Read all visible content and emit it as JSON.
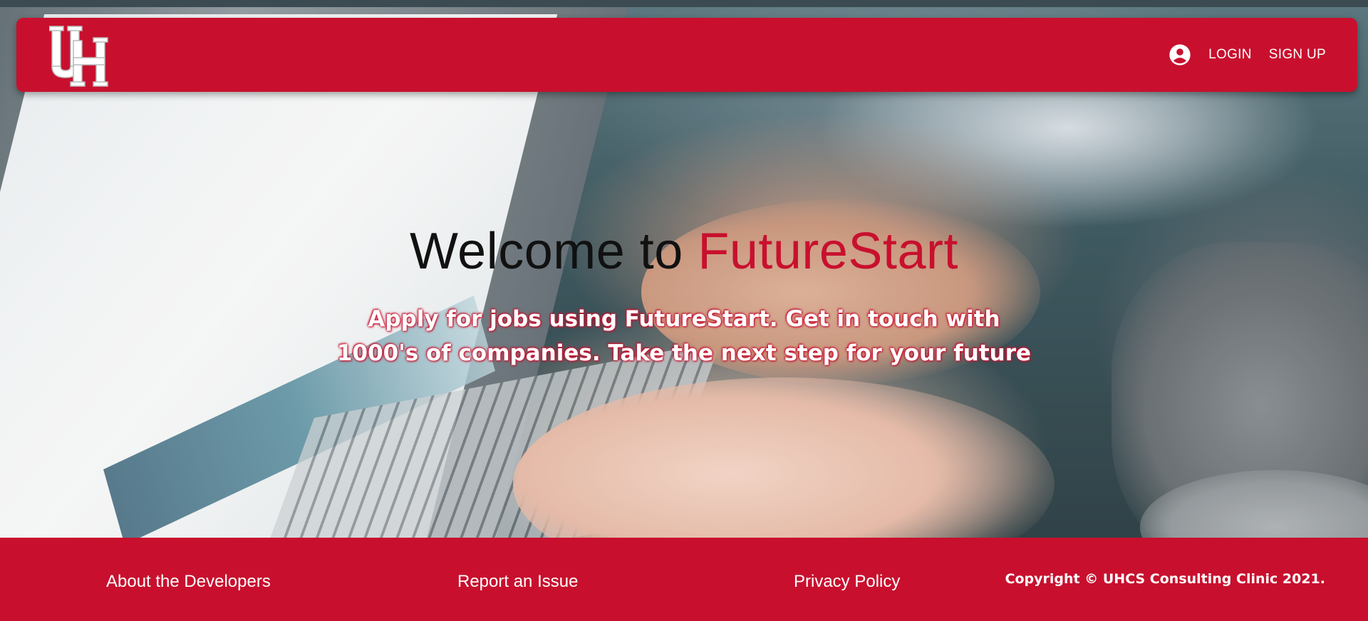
{
  "app": {
    "name": "FutureStart"
  },
  "header": {
    "logo_name": "UH",
    "account_icon": "account-circle-icon",
    "nav_items": [
      {
        "label": "LOGIN"
      },
      {
        "label": "SIGN UP"
      }
    ]
  },
  "hero": {
    "title_prefix": "Welcome to",
    "title_brand": "FutureStart",
    "subtitle": "Apply for jobs using FutureStart. Get in touch with 1000's of companies. Take the next step for your future"
  },
  "footer": {
    "links": [
      {
        "label": "About the Developers"
      },
      {
        "label": "Report an Issue"
      },
      {
        "label": "Privacy Policy"
      }
    ],
    "copyright": "Copyright © UHCS Consulting Clinic 2021."
  },
  "colors": {
    "brand_red": "#c8102e",
    "text_dark": "#111111",
    "text_light": "#ffffff"
  }
}
